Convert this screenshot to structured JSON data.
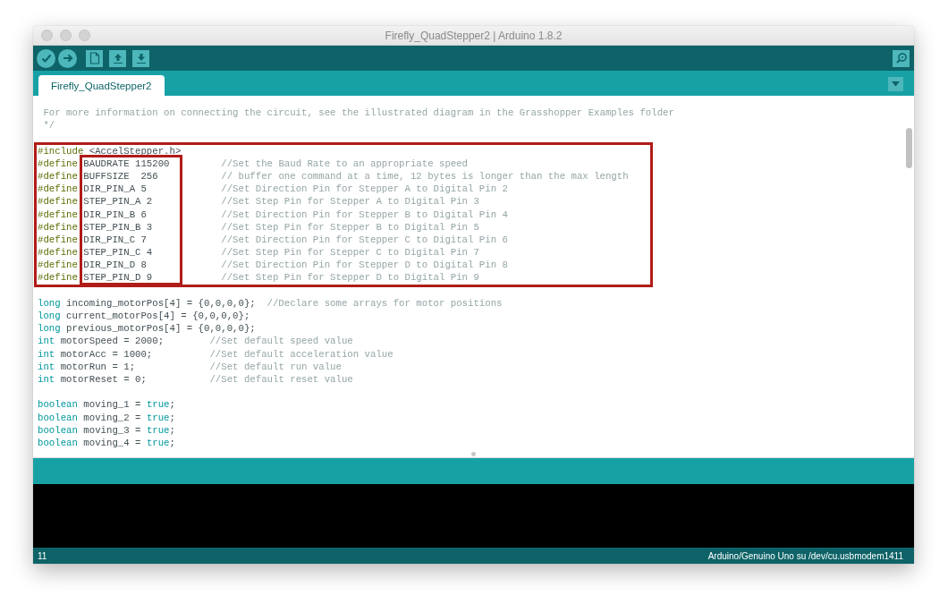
{
  "window": {
    "title": "Firefly_QuadStepper2 | Arduino 1.8.2"
  },
  "tabs": [
    {
      "label": "Firefly_QuadStepper2",
      "selected": true
    }
  ],
  "editor": {
    "lines": [
      {
        "kind": "code",
        "segments": [
          {
            "kind": "comment",
            "text": " For more information on connecting the circuit, see the illustrated diagram in the Grasshopper Examples folder"
          }
        ]
      },
      {
        "kind": "code",
        "segments": [
          {
            "kind": "comment",
            "text": " */"
          }
        ]
      },
      {
        "kind": "blank"
      },
      {
        "kind": "code",
        "segments": [
          {
            "kind": "directive",
            "text": "#include"
          },
          {
            "kind": "plain",
            "text": " <AccelStepper.h>"
          }
        ]
      },
      {
        "kind": "code",
        "segments": [
          {
            "kind": "directive",
            "text": "#define"
          },
          {
            "kind": "plain",
            "text": " BAUDRATE 115200         "
          },
          {
            "kind": "comment",
            "text": "//Set the Baud Rate to an appropriate speed"
          }
        ]
      },
      {
        "kind": "code",
        "segments": [
          {
            "kind": "directive",
            "text": "#define"
          },
          {
            "kind": "plain",
            "text": " BUFFSIZE  256           "
          },
          {
            "kind": "comment",
            "text": "// buffer one command at a time, 12 bytes is longer than the max length"
          }
        ]
      },
      {
        "kind": "code",
        "segments": [
          {
            "kind": "directive",
            "text": "#define"
          },
          {
            "kind": "plain",
            "text": " DIR_PIN_A 5             "
          },
          {
            "kind": "comment",
            "text": "//Set Direction Pin for Stepper A to Digital Pin 2"
          }
        ]
      },
      {
        "kind": "code",
        "segments": [
          {
            "kind": "directive",
            "text": "#define"
          },
          {
            "kind": "plain",
            "text": " STEP_PIN_A 2            "
          },
          {
            "kind": "comment",
            "text": "//Set Step Pin for Stepper A to Digital Pin 3"
          }
        ]
      },
      {
        "kind": "code",
        "segments": [
          {
            "kind": "directive",
            "text": "#define"
          },
          {
            "kind": "plain",
            "text": " DIR_PIN_B 6             "
          },
          {
            "kind": "comment",
            "text": "//Set Direction Pin for Stepper B to Digital Pin 4"
          }
        ]
      },
      {
        "kind": "code",
        "segments": [
          {
            "kind": "directive",
            "text": "#define"
          },
          {
            "kind": "plain",
            "text": " STEP_PIN_B 3            "
          },
          {
            "kind": "comment",
            "text": "//Set Step Pin for Stepper B to Digital Pin 5"
          }
        ]
      },
      {
        "kind": "code",
        "segments": [
          {
            "kind": "directive",
            "text": "#define"
          },
          {
            "kind": "plain",
            "text": " DIR_PIN_C 7             "
          },
          {
            "kind": "comment",
            "text": "//Set Direction Pin for Stepper C to Digital Pin 6"
          }
        ]
      },
      {
        "kind": "code",
        "segments": [
          {
            "kind": "directive",
            "text": "#define"
          },
          {
            "kind": "plain",
            "text": " STEP_PIN_C 4            "
          },
          {
            "kind": "comment",
            "text": "//Set Step Pin for Stepper C to Digital Pin 7"
          }
        ]
      },
      {
        "kind": "code",
        "segments": [
          {
            "kind": "directive",
            "text": "#define"
          },
          {
            "kind": "plain",
            "text": " DIR_PIN_D 8             "
          },
          {
            "kind": "comment",
            "text": "//Set Direction Pin for Stepper D to Digital Pin 8"
          }
        ]
      },
      {
        "kind": "code",
        "segments": [
          {
            "kind": "directive",
            "text": "#define"
          },
          {
            "kind": "plain",
            "text": " STEP_PIN_D 9            "
          },
          {
            "kind": "comment",
            "text": "//Set Step Pin for Stepper D to Digital Pin 9"
          }
        ]
      },
      {
        "kind": "blank"
      },
      {
        "kind": "code",
        "segments": [
          {
            "kind": "keyword",
            "text": "long"
          },
          {
            "kind": "plain",
            "text": " incoming_motorPos[4] = {0,0,0,0};  "
          },
          {
            "kind": "comment",
            "text": "//Declare some arrays for motor positions"
          }
        ]
      },
      {
        "kind": "code",
        "segments": [
          {
            "kind": "keyword",
            "text": "long"
          },
          {
            "kind": "plain",
            "text": " current_motorPos[4] = {0,0,0,0};"
          }
        ]
      },
      {
        "kind": "code",
        "segments": [
          {
            "kind": "keyword",
            "text": "long"
          },
          {
            "kind": "plain",
            "text": " previous_motorPos[4] = {0,0,0,0};"
          }
        ]
      },
      {
        "kind": "code",
        "segments": [
          {
            "kind": "keyword",
            "text": "int"
          },
          {
            "kind": "plain",
            "text": " motorSpeed = 2000;        "
          },
          {
            "kind": "comment",
            "text": "//Set default speed value"
          }
        ]
      },
      {
        "kind": "code",
        "segments": [
          {
            "kind": "keyword",
            "text": "int"
          },
          {
            "kind": "plain",
            "text": " motorAcc = 1000;          "
          },
          {
            "kind": "comment",
            "text": "//Set default acceleration value"
          }
        ]
      },
      {
        "kind": "code",
        "segments": [
          {
            "kind": "keyword",
            "text": "int"
          },
          {
            "kind": "plain",
            "text": " motorRun = 1;             "
          },
          {
            "kind": "comment",
            "text": "//Set default run value"
          }
        ]
      },
      {
        "kind": "code",
        "segments": [
          {
            "kind": "keyword",
            "text": "int"
          },
          {
            "kind": "plain",
            "text": " motorReset = 0;           "
          },
          {
            "kind": "comment",
            "text": "//Set default reset value"
          }
        ]
      },
      {
        "kind": "blank"
      },
      {
        "kind": "code",
        "segments": [
          {
            "kind": "keyword",
            "text": "boolean"
          },
          {
            "kind": "plain",
            "text": " moving_1 = "
          },
          {
            "kind": "keyword",
            "text": "true"
          },
          {
            "kind": "plain",
            "text": ";"
          }
        ]
      },
      {
        "kind": "code",
        "segments": [
          {
            "kind": "keyword",
            "text": "boolean"
          },
          {
            "kind": "plain",
            "text": " moving_2 = "
          },
          {
            "kind": "keyword",
            "text": "true"
          },
          {
            "kind": "plain",
            "text": ";"
          }
        ]
      },
      {
        "kind": "code",
        "segments": [
          {
            "kind": "keyword",
            "text": "boolean"
          },
          {
            "kind": "plain",
            "text": " moving_3 = "
          },
          {
            "kind": "keyword",
            "text": "true"
          },
          {
            "kind": "plain",
            "text": ";"
          }
        ]
      },
      {
        "kind": "code",
        "segments": [
          {
            "kind": "keyword",
            "text": "boolean"
          },
          {
            "kind": "plain",
            "text": " moving_4 = "
          },
          {
            "kind": "keyword",
            "text": "true"
          },
          {
            "kind": "plain",
            "text": ";"
          }
        ]
      }
    ]
  },
  "status_bar": {
    "line": "11",
    "board": "Arduino/Genuino Uno su /dev/cu.usbmodem1411"
  }
}
